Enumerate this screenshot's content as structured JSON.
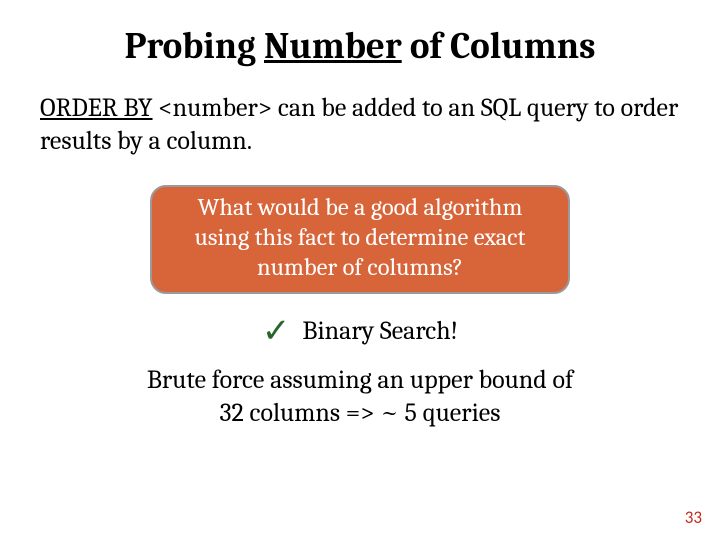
{
  "title": {
    "part1": "Probing ",
    "underlined": "Number",
    "part2": " of Columns"
  },
  "desc": {
    "keyword": "ORDER BY",
    "rest": " <number> can be added to an SQL query to order results by a column."
  },
  "callout": "What would be a good algorithm using this fact to determine exact number of columns?",
  "answer": "Binary Search!",
  "note": "Brute force assuming an upper bound of 32 columns => ~ 5 queries",
  "page": "33",
  "icons": {
    "check": "✓"
  }
}
